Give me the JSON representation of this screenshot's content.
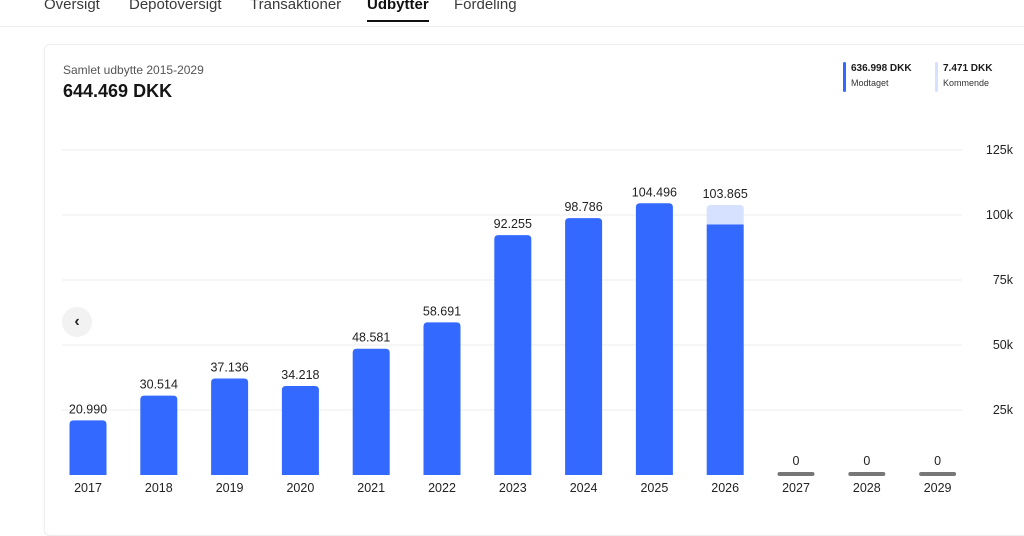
{
  "tabs": [
    {
      "label": "Oversigt",
      "active": false
    },
    {
      "label": "Depotoversigt",
      "active": false
    },
    {
      "label": "Transaktioner",
      "active": false
    },
    {
      "label": "Udbytter",
      "active": true
    },
    {
      "label": "Fordeling",
      "active": false
    }
  ],
  "summary": {
    "subtitle": "Samlet udbytte 2015-2029",
    "total": "644.469 DKK"
  },
  "legend": {
    "received": {
      "value": "636.998 DKK",
      "label": "Modtaget",
      "color": "#3369ff"
    },
    "upcoming": {
      "value": "7.471 DKK",
      "label": "Kommende",
      "color": "#d5e1ff"
    }
  },
  "nav": {
    "prev_icon": "‹"
  },
  "chart_data": {
    "type": "bar",
    "stacked": true,
    "categories": [
      "2017",
      "2018",
      "2019",
      "2020",
      "2021",
      "2022",
      "2023",
      "2024",
      "2025",
      "2026",
      "2027",
      "2028",
      "2029"
    ],
    "series": [
      {
        "name": "Modtaget",
        "color": "#3369ff",
        "values": [
          20990,
          30514,
          37136,
          34218,
          48581,
          58691,
          92255,
          98786,
          104496,
          96394,
          0,
          0,
          0
        ]
      },
      {
        "name": "Kommende",
        "color": "#d5e1ff",
        "values": [
          0,
          0,
          0,
          0,
          0,
          0,
          0,
          0,
          0,
          7471,
          0,
          0,
          0
        ]
      }
    ],
    "data_labels": [
      "20.990",
      "30.514",
      "37.136",
      "34.218",
      "48.581",
      "58.691",
      "92.255",
      "98.786",
      "104.496",
      "103.865",
      "0",
      "0",
      "0"
    ],
    "zero_bar_color": "#777777",
    "yticks": [
      25000,
      50000,
      75000,
      100000,
      125000
    ],
    "ytick_labels": [
      "25k",
      "50k",
      "75k",
      "100k",
      "125k"
    ],
    "ylim": [
      0,
      125000
    ],
    "y_axis_position": "right",
    "grid": true
  }
}
